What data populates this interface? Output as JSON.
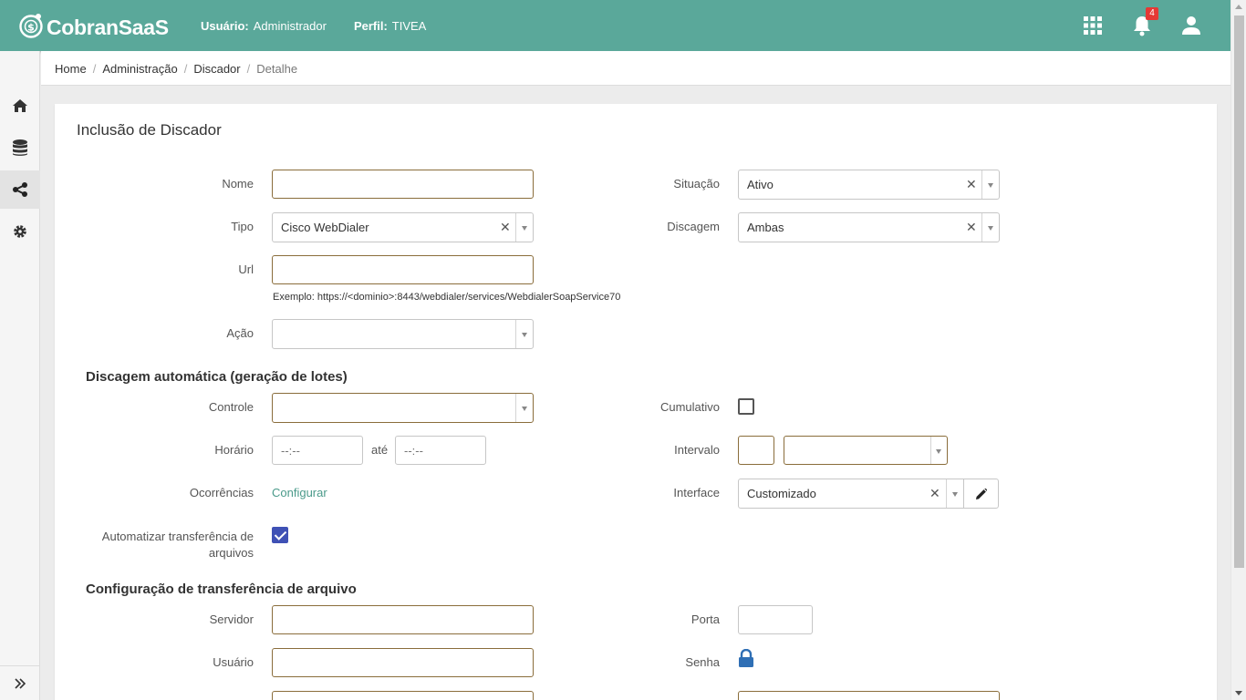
{
  "app": {
    "name": "CobranSaaS"
  },
  "header": {
    "user_label": "Usuário:",
    "user_value": "Administrador",
    "profile_label": "Perfil:",
    "profile_value": "TIVEA",
    "notification_count": "4",
    "icons": [
      "apps-grid-icon",
      "bell-icon",
      "user-icon"
    ]
  },
  "sidebar": {
    "items": [
      {
        "icon": "home-icon"
      },
      {
        "icon": "database-icon"
      },
      {
        "icon": "share-icon",
        "active": true
      },
      {
        "icon": "gear-icon"
      }
    ],
    "footer_icon": "expand-icon"
  },
  "breadcrumb": [
    "Home",
    "Administração",
    "Discador",
    "Detalhe"
  ],
  "page": {
    "title": "Inclusão de Discador"
  },
  "form": {
    "nome_label": "Nome",
    "nome_value": "",
    "situacao_label": "Situação",
    "situacao_value": "Ativo",
    "tipo_label": "Tipo",
    "tipo_value": "Cisco WebDialer",
    "discagem_label": "Discagem",
    "discagem_value": "Ambas",
    "url_label": "Url",
    "url_value": "",
    "url_hint": "Exemplo: https://<dominio>:8443/webdialer/services/WebdialerSoapService70",
    "acao_label": "Ação",
    "acao_value": ""
  },
  "auto": {
    "section_title": "Discagem automática (geração de lotes)",
    "controle_label": "Controle",
    "controle_value": "",
    "cumulativo_label": "Cumulativo",
    "cumulativo_checked": false,
    "horario_label": "Horário",
    "horario_from_placeholder": "--:--",
    "ate_label": "até",
    "horario_to_placeholder": "--:--",
    "intervalo_label": "Intervalo",
    "ocorrencias_label": "Ocorrências",
    "configurar_link": "Configurar",
    "interface_label": "Interface",
    "interface_value": "Customizado",
    "automatizar_label": "Automatizar transferência de arquivos",
    "automatizar_checked": true
  },
  "transfer": {
    "section_title": "Configuração de transferência de arquivo",
    "servidor_label": "Servidor",
    "porta_label": "Porta",
    "usuario_label": "Usuário",
    "senha_label": "Senha"
  },
  "colors": {
    "header": "#5aa89a",
    "required_border": "#8a6d3b",
    "link": "#4a9a8a",
    "checkbox": "#3f51b5",
    "lock": "#2f6fb5",
    "badge": "#e53935"
  }
}
